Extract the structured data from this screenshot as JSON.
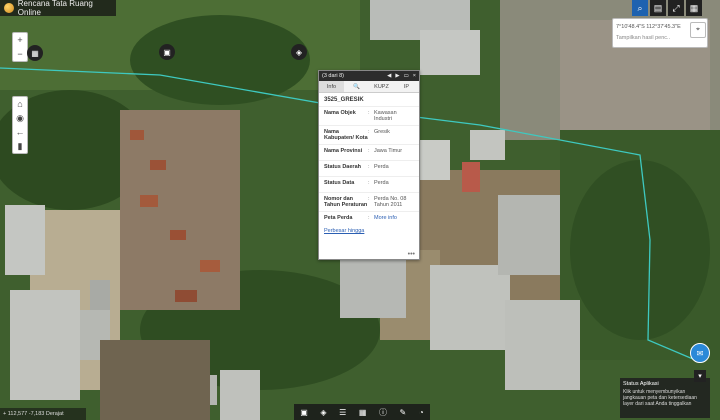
{
  "app": {
    "title": "Rencana Tata Ruang Online"
  },
  "map_controls": {
    "zoom_in": "+",
    "zoom_out": "−"
  },
  "search": {
    "value": "7°10'48.4\"S 112°37'45.3\"E",
    "hint": "Tampilkan hasil penc.."
  },
  "popup": {
    "counter": "(3 dari 8)",
    "tabs": [
      "Info",
      "🔍",
      "KUPZ",
      "IP"
    ],
    "title": "3525_GRESIK",
    "rows": [
      {
        "label": "Nama Objek",
        "value": "Kawasan Industri"
      },
      {
        "label": "Nama Kabupaten/ Kota",
        "value": "Gresik"
      },
      {
        "label": "Nama Provinsi",
        "value": "Jawa Timur"
      },
      {
        "label": "Status Daerah",
        "value": "Perda"
      },
      {
        "label": "Status Data",
        "value": "Perda"
      },
      {
        "label": "Nomor dan Tahun Peraturan",
        "value": "Perda No. 08 Tahun 2011"
      },
      {
        "label": "Peta Perda",
        "value": "More info"
      }
    ],
    "zoom_link": "Perbesar hingga",
    "more": "•••"
  },
  "coords": "+ 112,577 -7,183 Derajat",
  "status_panel": {
    "title": "Status Aplikasi",
    "text": "Klik untuk menyembunyikan jangkauan peta dan ketersediaan layer dari saat Anda tinggalkan"
  },
  "colors": {
    "popup_header": "#2c2c2c",
    "boundary": "#3ec9c0",
    "accent": "#2a89d8"
  },
  "icons": [
    "search-icon",
    "print-icon",
    "fullscreen-icon",
    "grid-icon",
    "home-icon",
    "locate-icon",
    "back-icon",
    "ruler-icon",
    "layers-icon",
    "basemap-icon",
    "legend-icon",
    "info-icon",
    "pencil-icon",
    "location-pin-icon",
    "chat-icon"
  ]
}
